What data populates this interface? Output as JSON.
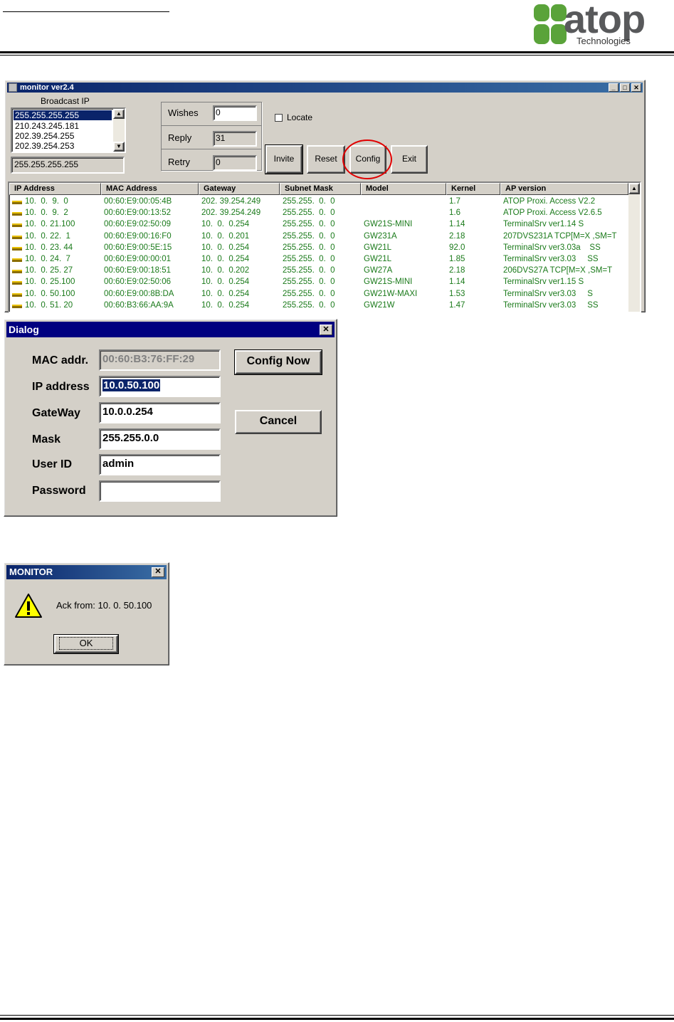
{
  "logo": {
    "name": "atop",
    "sub": "Technologies"
  },
  "monitor": {
    "title": "monitor ver2.4",
    "broadcast_label": "Broadcast IP",
    "broadcast_list": [
      "255.255.255.255",
      "210.243.245.181",
      "202.39.254.255",
      "202.39.254.253"
    ],
    "broadcast_value": "255.255.255.255",
    "wishes_label": "Wishes",
    "wishes_value": "0",
    "reply_label": "Reply",
    "reply_value": "31",
    "retry_label": "Retry",
    "retry_value": "0",
    "locate_label": "Locate",
    "buttons": {
      "invite": "Invite",
      "reset": "Reset",
      "config": "Config",
      "exit": "Exit"
    },
    "columns": [
      "IP Address",
      "MAC Address",
      "Gateway",
      "Subnet Mask",
      "Model",
      "Kernel",
      "AP version"
    ],
    "rows": [
      [
        "10.  0.  9.  0",
        "00:60:E9:00:05:4B",
        "202. 39.254.249",
        "255.255.  0.  0",
        "",
        "1.7",
        "ATOP Proxi. Access V2.2"
      ],
      [
        "10.  0.  9.  2",
        "00:60:E9:00:13:52",
        "202. 39.254.249",
        "255.255.  0.  0",
        "",
        "1.6",
        "ATOP Proxi. Access V2.6.5"
      ],
      [
        "10.  0. 21.100",
        "00:60:E9:02:50:09",
        "10.  0.  0.254",
        "255.255.  0.  0",
        "GW21S-MINI",
        "1.14",
        "TerminalSrv ver1.14 S"
      ],
      [
        "10.  0. 22.  1",
        "00:60:E9:00:16:F0",
        "10.  0.  0.201",
        "255.255.  0.  0",
        "GW231A",
        "2.18",
        "207DVS231A TCP[M=X ,SM=T"
      ],
      [
        "10.  0. 23. 44",
        "00:60:E9:00:5E:15",
        "10.  0.  0.254",
        "255.255.  0.  0",
        "GW21L",
        "92.0",
        "TerminalSrv ver3.03a    SS"
      ],
      [
        "10.  0. 24.  7",
        "00:60:E9:00:00:01",
        "10.  0.  0.254",
        "255.255.  0.  0",
        "GW21L",
        "1.85",
        "TerminalSrv ver3.03     SS"
      ],
      [
        "10.  0. 25. 27",
        "00:60:E9:00:18:51",
        "10.  0.  0.202",
        "255.255.  0.  0",
        "GW27A",
        "2.18",
        "206DVS27A TCP[M=X ,SM=T"
      ],
      [
        "10.  0. 25.100",
        "00:60:E9:02:50:06",
        "10.  0.  0.254",
        "255.255.  0.  0",
        "GW21S-MINI",
        "1.14",
        "TerminalSrv ver1.15 S"
      ],
      [
        "10.  0. 50.100",
        "00:60:E9:00:8B:DA",
        "10.  0.  0.254",
        "255.255.  0.  0",
        "GW21W-MAXI",
        "1.53",
        "TerminalSrv ver3.03     S"
      ],
      [
        "10.  0. 51. 20",
        "00:60:B3:66:AA:9A",
        "10.  0.  0.254",
        "255.255.  0.  0",
        "GW21W",
        "1.47",
        "TerminalSrv ver3.03     SS"
      ]
    ],
    "highlight_color": "#e00000"
  },
  "dialog": {
    "title": "Dialog",
    "mac_label": "MAC addr.",
    "mac_value": "00:60:B3:76:FF:29",
    "ip_label": "IP address",
    "ip_value": "10.0.50.100",
    "gw_label": "GateWay",
    "gw_value": "10.0.0.254",
    "mask_label": "Mask",
    "mask_value": "255.255.0.0",
    "user_label": "User ID",
    "user_value": "admin",
    "pass_label": "Password",
    "pass_value": "",
    "config_now": "Config Now",
    "cancel": "Cancel"
  },
  "msgbox": {
    "title": "MONITOR",
    "message": "Ack from:  10.  0. 50.100",
    "ok": "OK"
  }
}
